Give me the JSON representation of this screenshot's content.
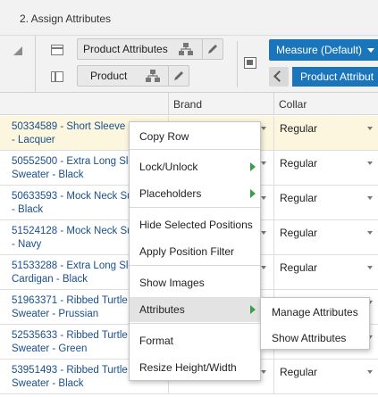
{
  "panel": {
    "title": "2. Assign Attributes"
  },
  "pivot": {
    "row_tiles": [
      {
        "label": "Product Attributes"
      },
      {
        "label": "Product"
      }
    ],
    "measure_button": "Measure (Default)",
    "column_tile": "Product Attribut"
  },
  "grid": {
    "columns": [
      "Brand",
      "Collar"
    ],
    "rows": [
      {
        "line1": "50334589 - Short Sleeve S",
        "line2": "- Lacquer",
        "collar": "Regular",
        "selected": true
      },
      {
        "line1": "50552500 - Extra Long Sle",
        "line2": "Sweater - Black",
        "collar": "Regular"
      },
      {
        "line1": "50633593 - Mock Neck Su",
        "line2": "- Black",
        "collar": "Regular"
      },
      {
        "line1": "51524128 - Mock Neck Su",
        "line2": "- Navy",
        "collar": "Regular"
      },
      {
        "line1": "51533288 - Extra Long Sle",
        "line2": "Cardigan - Black",
        "collar": "Regular"
      },
      {
        "line1": "51963371 - Ribbed Turtle",
        "line2": "Sweater - Prussian",
        "collar": ""
      },
      {
        "line1": "52535633 - Ribbed Turtle",
        "line2": "Sweater - Green",
        "collar": ""
      },
      {
        "line1": "53951493 - Ribbed Turtle",
        "line2": "Sweater - Black",
        "collar": "Regular"
      }
    ]
  },
  "context_menu": {
    "items": [
      {
        "label": "Copy Row"
      },
      {
        "label": "Lock/Unlock",
        "submenu": true
      },
      {
        "label": "Placeholders",
        "submenu": true
      },
      {
        "label": "Hide Selected Positions"
      },
      {
        "label": "Apply Position Filter"
      },
      {
        "label": "Show Images"
      },
      {
        "label": "Attributes",
        "submenu": true,
        "highlighted": true
      },
      {
        "label": "Format"
      },
      {
        "label": "Resize Height/Width"
      }
    ],
    "submenu_items": [
      {
        "label": "Manage Attributes"
      },
      {
        "label": "Show Attributes"
      }
    ]
  },
  "colors": {
    "accent": "#1b75bb",
    "submenu_arrow": "#3c9d49",
    "selected_row": "#fbf6dd",
    "row_header_text": "#1a4f8b"
  }
}
